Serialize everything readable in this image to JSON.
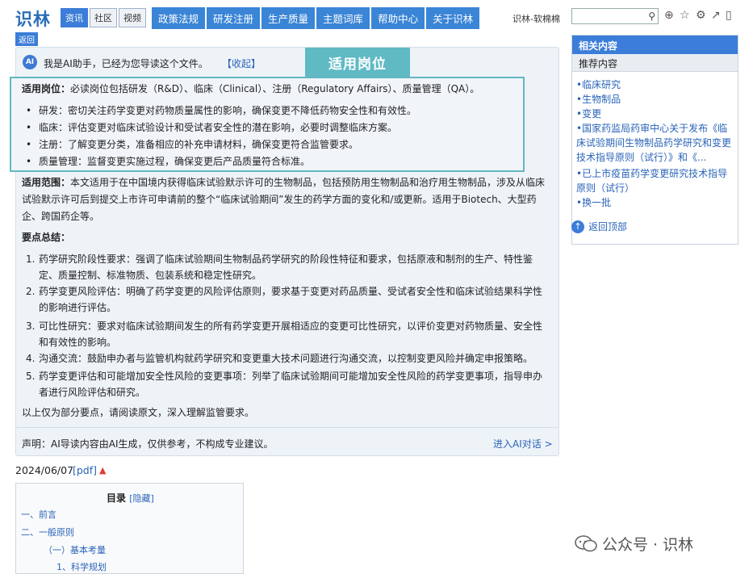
{
  "header": {
    "logo": "识林",
    "subtabs": [
      "资讯",
      "社区",
      "视频"
    ],
    "nav": [
      "政策法规",
      "研发注册",
      "生产质量",
      "主题词库",
      "帮助中心",
      "关于识林"
    ],
    "back_label": "返回",
    "user": "识林-软棉棉",
    "search_placeholder": ""
  },
  "ai": {
    "badge": "AI",
    "intro": "我是AI助手，已经为您导读这个文件。",
    "collapse": "【收起】",
    "banner": "适用岗位",
    "roles_label": "适用岗位：",
    "roles_text": "必读岗位包括研发（R&D）、临床（Clinical）、注册（Regulatory Affairs）、质量管理（QA）。",
    "roles": [
      "研发：密切关注药学变更对药物质量属性的影响，确保变更不降低药物安全性和有效性。",
      "临床：评估变更对临床试验设计和受试者安全性的潜在影响，必要时调整临床方案。",
      "注册：了解变更分类，准备相应的补充申请材料，确保变更符合监管要求。",
      "质量管理：监督变更实施过程，确保变更后产品质量符合标准。"
    ],
    "scope_label": "适用范围：",
    "scope_line1": "本文适用于在中国境内获得临床试验默示许可的生物制品，包括预防用生物制品和治疗用生物制品，涉及从临床",
    "scope_line2": "试验默示许可后到提交上市许可申请前的整个“临床试验期间”发生的药学方面的变化和/或更新。适用于Biotech、大型药",
    "scope_line3": "企、跨国药企等。",
    "summary_label": "要点总结：",
    "summary": [
      {
        "num": "1.",
        "l1": "药学研究阶段性要求：强调了临床试验期间生物制品药学研究的阶段性特征和要求，包括原液和制剂的生产、特性鉴",
        "l2": "定、质量控制、标准物质、包装系统和稳定性研究。"
      },
      {
        "num": "2.",
        "l1": "药学变更风险评估：明确了药学变更的风险评估原则，要求基于变更对药品质量、受试者安全性和临床试验结果科学性",
        "l2": "的影响进行评估。"
      },
      {
        "num": "3.",
        "l1": "可比性研究：要求对临床试验期间发生的所有药学变更开展相适应的变更可比性研究，以评价变更对药物质量、安全性",
        "l2": "和有效性的影响。"
      },
      {
        "num": "4.",
        "l1": "沟通交流：鼓励申办者与监管机构就药学研究和变更重大技术问题进行沟通交流，以控制变更风险并确定申报策略。",
        "l2": ""
      },
      {
        "num": "5.",
        "l1": "药学变更评估和可能增加安全性风险的变更事项：列举了临床试验期间可能增加安全性风险的药学变更事项，指导申办",
        "l2": "者进行风险评估和研究。"
      }
    ],
    "footer_note": "以上仅为部分要点，请阅读原文，深入理解监管要求。",
    "disclaimer": "声明：AI导读内容由AI生成，仅供参考，不构成专业建议。",
    "enter_ai": "进入AI对话 >"
  },
  "doc": {
    "date": "2024/06/07",
    "pdf": "[pdf]"
  },
  "toc": {
    "title": "目录",
    "hide": "[隐藏]",
    "items": [
      "一、前言",
      "二、一般原则",
      "（一）基本考量",
      "1、科学规划"
    ]
  },
  "sidebar": {
    "title": "相关内容",
    "subtitle": "推荐内容",
    "links": [
      "•临床研究",
      "•生物制品",
      "•变更",
      "•国家药监局药审中心关于发布《临床试验期间生物制品药学研究和变更技术指导原则（试行）》和《...",
      "•已上市疫苗药学变更研究技术指导原则（试行）",
      "•换一批"
    ],
    "back_top": "返回顶部"
  },
  "watermark": "公众号 · 识林",
  "colors": {
    "accent": "#3b7dd8",
    "highlight": "#63b7c1",
    "link": "#2a64b8"
  }
}
